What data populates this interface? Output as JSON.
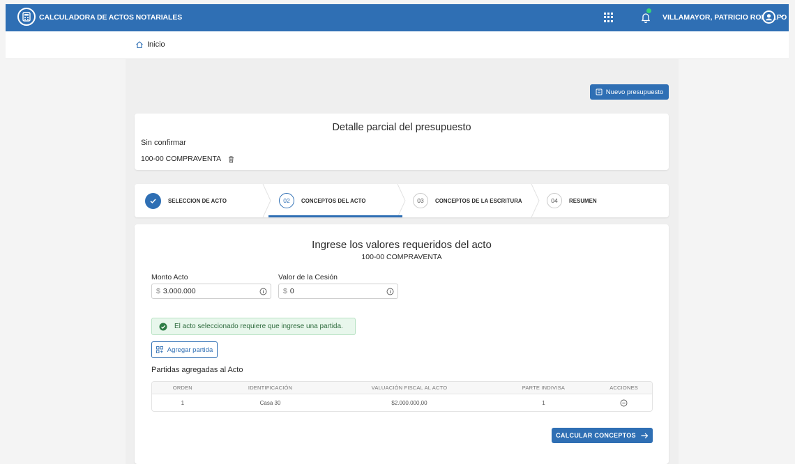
{
  "header": {
    "app_title": "CALCULADORA DE ACTOS NOTARIALES",
    "user_name": "VILLAMAYOR, PATRICIO RODOLFO",
    "accent_color": "#2f6fb4",
    "notification_dot_color": "#36d27a"
  },
  "breadcrumb": {
    "home_label": "Inicio"
  },
  "actions": {
    "nuevo_presupuesto_label": "Nuevo presupuesto"
  },
  "detalle": {
    "title": "Detalle parcial del presupuesto",
    "status": "Sin confirmar",
    "acto": "100-00 COMPRAVENTA"
  },
  "steps": [
    {
      "number": "",
      "label": "SELECCION DE ACTO",
      "state": "done"
    },
    {
      "number": "02",
      "label": "CONCEPTOS DEL ACTO",
      "state": "active"
    },
    {
      "number": "03",
      "label": "CONCEPTOS DE LA ESCRITURA",
      "state": "pending"
    },
    {
      "number": "04",
      "label": "RESUMEN",
      "state": "pending"
    }
  ],
  "form": {
    "title": "Ingrese los valores requeridos del acto",
    "subtitle": "100-00 COMPRAVENTA",
    "monto_label": "Monto Acto",
    "monto_currency": "$",
    "monto_value": "3.000.000",
    "cesion_label": "Valor de la Cesión",
    "cesion_currency": "$",
    "cesion_value": "0",
    "alert_text": "El acto seleccionado requiere que ingrese una partida.",
    "agregar_label": "Agregar partida",
    "partidas_title": "Partidas agregadas al Acto",
    "calcular_label": "CALCULAR CONCEPTOS"
  },
  "table": {
    "headers": [
      "ORDEN",
      "IDENTIFICACIÓN",
      "VALUACIÓN FISCAL AL ACTO",
      "PARTE INDIVISA",
      "ACCIONES"
    ],
    "rows": [
      {
        "orden": "1",
        "identificacion": "Casa 30",
        "valuacion": "$2.000.000,00",
        "parte": "1"
      }
    ]
  }
}
